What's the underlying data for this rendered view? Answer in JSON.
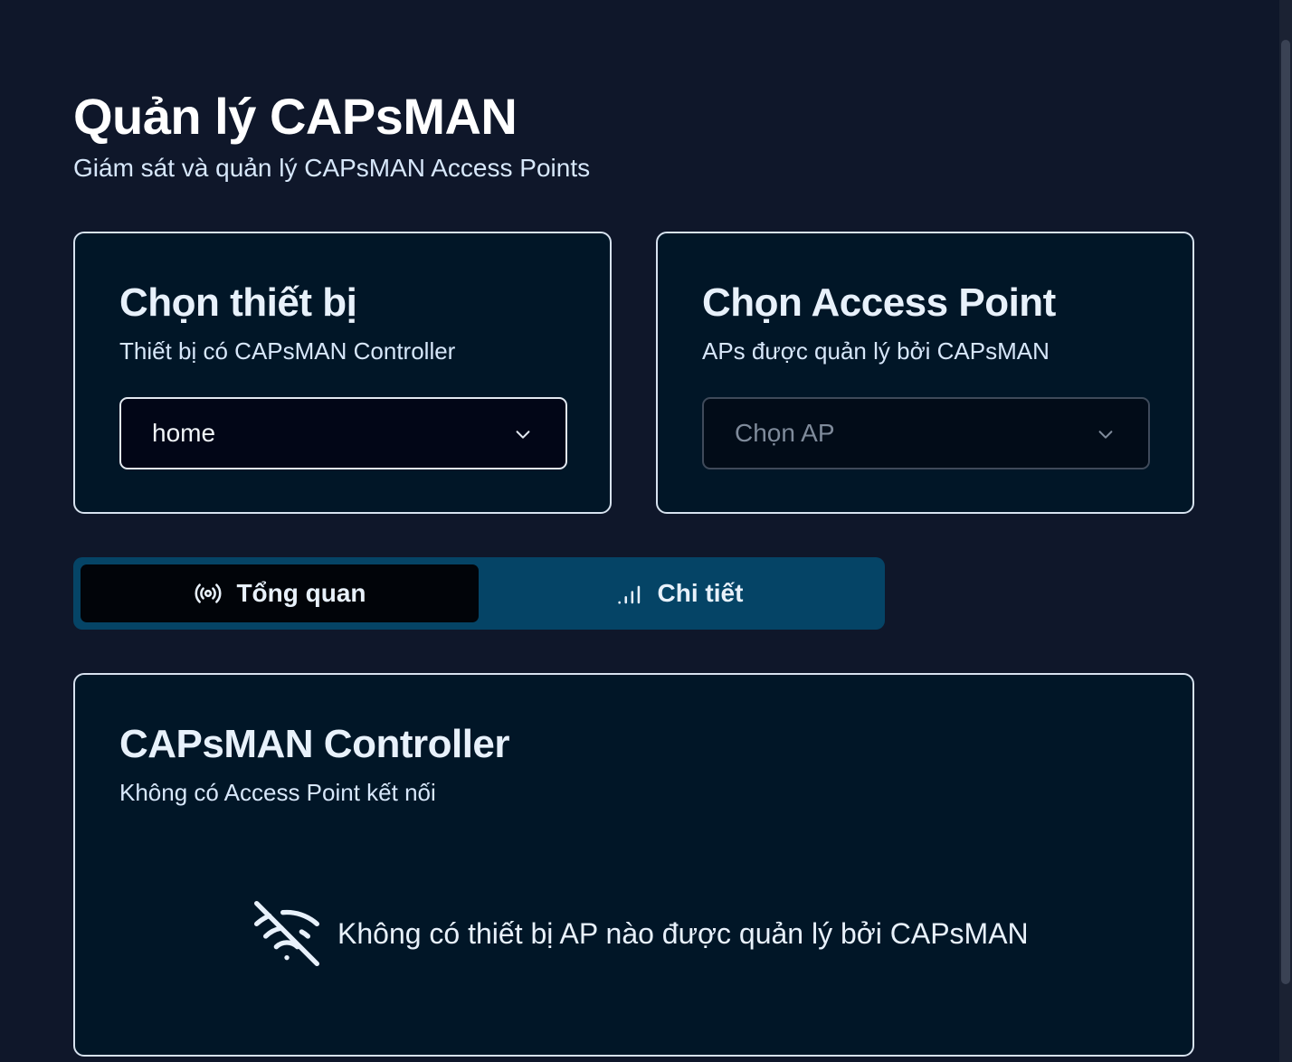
{
  "header": {
    "title": "Quản lý CAPsMAN",
    "subtitle": "Giám sát và quản lý CAPsMAN Access Points"
  },
  "device_card": {
    "title": "Chọn thiết bị",
    "description": "Thiết bị có CAPsMAN Controller",
    "select_value": "home",
    "icon": "chevron-down-icon"
  },
  "ap_card": {
    "title": "Chọn Access Point",
    "description": "APs được quản lý bởi CAPsMAN",
    "select_placeholder": "Chọn AP",
    "icon": "chevron-down-icon"
  },
  "tabs": [
    {
      "label": "Tổng quan",
      "icon": "radio-icon",
      "active": true
    },
    {
      "label": "Chi tiết",
      "icon": "signal-icon",
      "active": false
    }
  ],
  "controller_card": {
    "title": "CAPsMAN Controller",
    "description": "Không có Access Point kết nối",
    "empty_message": "Không có thiết bị AP nào được quản lý bởi CAPsMAN",
    "empty_icon": "wifi-off-icon"
  },
  "colors": {
    "page_bg": "#0f172a",
    "card_bg": "#011627",
    "tab_bar_bg": "#054466",
    "active_tab_bg": "#010409"
  }
}
